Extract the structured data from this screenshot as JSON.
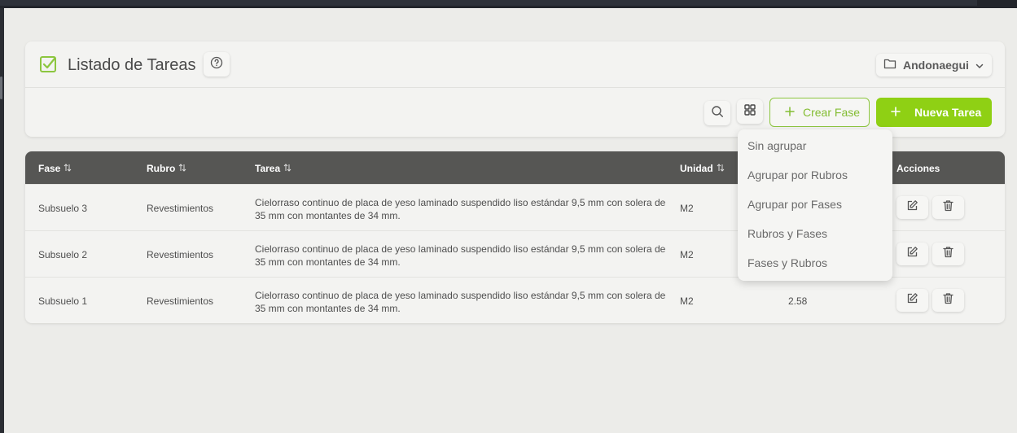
{
  "header": {
    "title": "Listado de Tareas",
    "project": "Andonaegui"
  },
  "toolbar": {
    "crear_fase": "Crear Fase",
    "nueva_tarea": "Nueva Tarea",
    "icons": [
      "search-icon",
      "grid-icon",
      "plus-icon"
    ]
  },
  "table": {
    "columns": [
      "Fase",
      "Rubro",
      "Tarea",
      "Unidad",
      "Acciones"
    ],
    "rows": [
      {
        "fase": "Subsuelo 3",
        "rubro": "Revestimientos",
        "tarea": "Cielorraso continuo de placa de yeso laminado suspendido liso estándar 9,5 mm con solera de 35 mm con montantes de 34 mm.",
        "unidad": "M2",
        "cantidad": ""
      },
      {
        "fase": "Subsuelo 2",
        "rubro": "Revestimientos",
        "tarea": "Cielorraso continuo de placa de yeso laminado suspendido liso estándar 9,5 mm con solera de 35 mm con montantes de 34 mm.",
        "unidad": "M2",
        "cantidad": ""
      },
      {
        "fase": "Subsuelo 1",
        "rubro": "Revestimientos",
        "tarea": "Cielorraso continuo de placa de yeso laminado suspendido liso estándar 9,5 mm con solera de 35 mm con montantes de 34 mm.",
        "unidad": "M2",
        "cantidad": "2.58"
      }
    ]
  },
  "group_menu": {
    "options": [
      "Sin agrupar",
      "Agrupar por Rubros",
      "Agrupar por Fases",
      "Rubros y Fases",
      "Fases y Rubros"
    ]
  },
  "colors": {
    "accent": "#8fd014",
    "accent_text": "#84bd33",
    "table_header": "#565654"
  }
}
